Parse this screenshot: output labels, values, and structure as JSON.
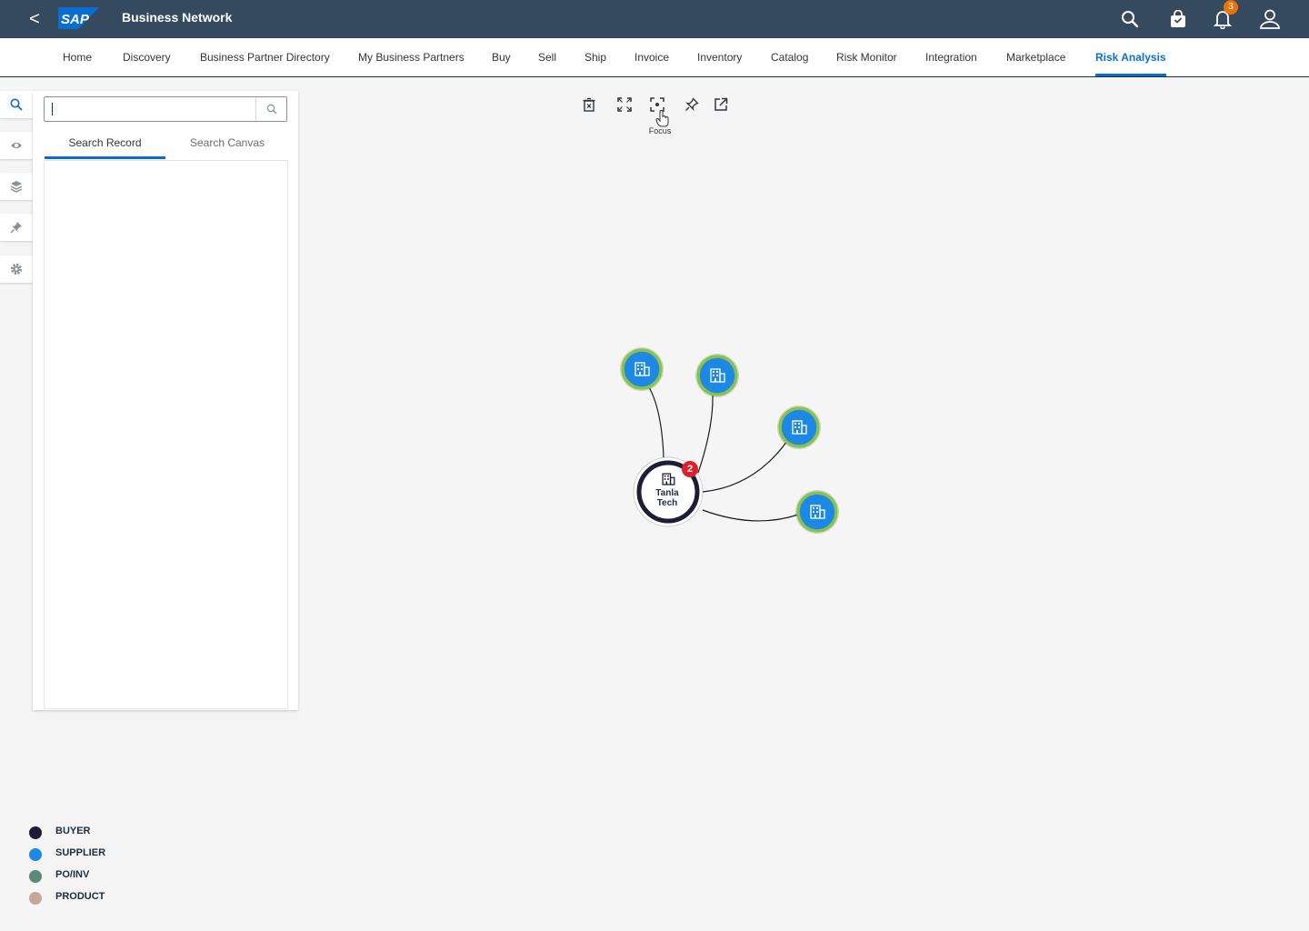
{
  "shell": {
    "back_label": "<",
    "logo_text": "SAP",
    "app_title": "Business Network",
    "notification_count": "3",
    "icons": [
      "search-icon",
      "shopping-bag-icon",
      "bell-icon",
      "user-icon"
    ]
  },
  "nav": {
    "tabs": [
      {
        "label": "Home",
        "active": false
      },
      {
        "label": "Discovery",
        "active": false
      },
      {
        "label": "Business Partner Directory",
        "active": false
      },
      {
        "label": "My Business Partners",
        "active": false
      },
      {
        "label": "Buy",
        "active": false
      },
      {
        "label": "Sell",
        "active": false
      },
      {
        "label": "Ship",
        "active": false
      },
      {
        "label": "Invoice",
        "active": false
      },
      {
        "label": "Inventory",
        "active": false
      },
      {
        "label": "Catalog",
        "active": false
      },
      {
        "label": "Risk Monitor",
        "active": false
      },
      {
        "label": "Integration",
        "active": false
      },
      {
        "label": "Marketplace",
        "active": false
      },
      {
        "label": "Risk Analysis",
        "active": true
      }
    ]
  },
  "rail": {
    "icons": [
      "search-icon",
      "eye-icon",
      "layers-icon",
      "pin-icon",
      "gear-icon"
    ]
  },
  "panel": {
    "search": {
      "value": "",
      "placeholder": ""
    },
    "tabs": [
      {
        "label": "Search Record",
        "active": true
      },
      {
        "label": "Search Canvas",
        "active": false
      }
    ]
  },
  "toolbar": {
    "icons": [
      "delete-icon",
      "fullscreen-icon",
      "focus-icon",
      "pin-icon",
      "open-external-icon"
    ],
    "tooltip": "Focus"
  },
  "graph": {
    "center": {
      "label_line1": "Tanla",
      "label_line2": "Tech",
      "badge": "2",
      "type": "BUYER"
    },
    "neighbors_count": 4,
    "neighbor_type": "SUPPLIER"
  },
  "legend": [
    {
      "label": "BUYER",
      "color": "#1d1d35"
    },
    {
      "label": "SUPPLIER",
      "color": "#1e88e5"
    },
    {
      "label": "PO/INV",
      "color": "#5b8a7a"
    },
    {
      "label": "PRODUCT",
      "color": "#c4a89a"
    }
  ],
  "colors": {
    "shell_bg": "#354a5f",
    "accent": "#0a6ed1",
    "supplier_fill": "#1e88e5",
    "supplier_ring": "#8bc34a",
    "buyer_ring": "#1d1d35",
    "badge_red": "#e01f26",
    "notification_orange": "#e9730c"
  }
}
